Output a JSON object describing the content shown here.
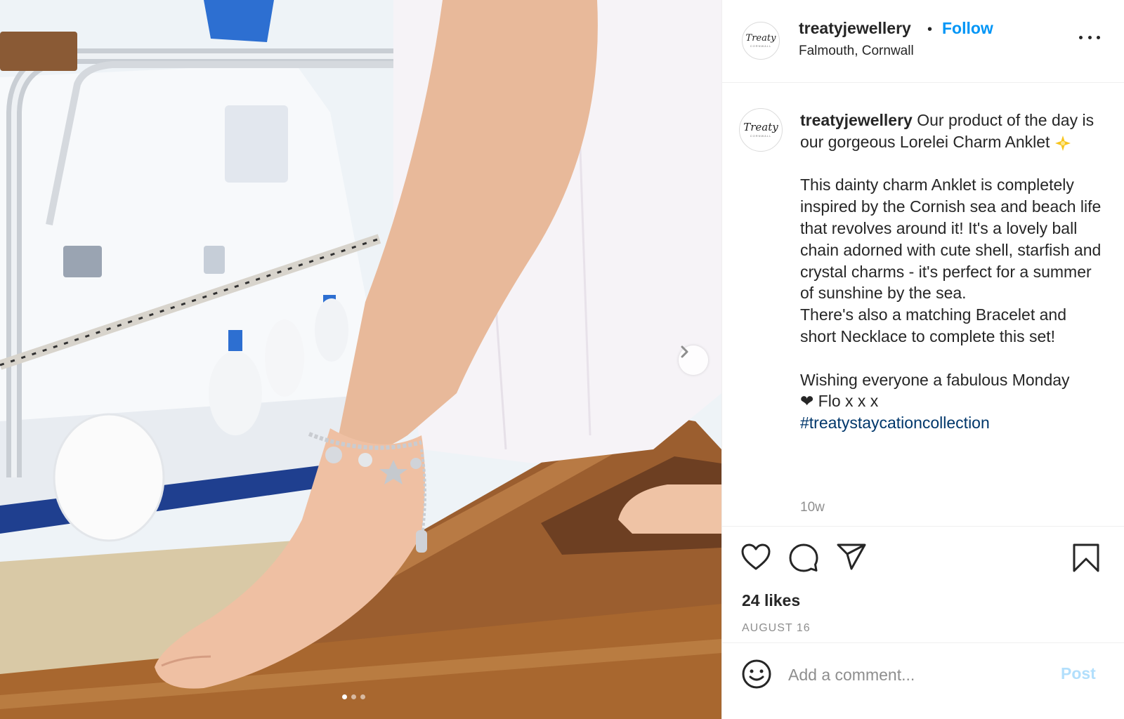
{
  "post": {
    "username": "treatyjewellery",
    "follow_label": "Follow",
    "separator": "•",
    "location": "Falmouth, Cornwall",
    "avatar_logo": "Treaty",
    "avatar_sub": "CORNWALL",
    "caption": {
      "username": "treatyjewellery",
      "line_1": " Our product of the day is our gorgeous Lorelei Charm Anklet ",
      "body": "This dainty charm Anklet is completely inspired by the Cornish sea and beach life that revolves around it! It's a lovely ball chain adorned with cute shell, starfish and crystal charms - it's perfect for a summer of sunshine by the sea.\nThere's also a matching Bracelet and short Necklace to complete this set!",
      "closing": "Wishing everyone a fabulous Monday",
      "heart": "❤",
      "signoff": " Flo x x x",
      "hashtag": "#treatystaycationcollection"
    },
    "time_ago": "10w",
    "likes": "24 likes",
    "date": "AUGUST 16",
    "comment_placeholder": "Add a comment...",
    "post_label": "Post",
    "carousel": {
      "total_slides": 3,
      "active_slide": 1
    },
    "icons": {
      "like": "heart-outline-icon",
      "comment": "speech-bubble-icon",
      "share": "paper-plane-icon",
      "save": "bookmark-icon",
      "emoji": "smiley-icon",
      "more": "ellipsis-icon",
      "next": "chevron-right-icon"
    },
    "colors": {
      "accent": "#0095f6",
      "hashtag": "#00376b",
      "muted": "#8e8e8e",
      "post_disabled": "#b2dffc"
    }
  }
}
